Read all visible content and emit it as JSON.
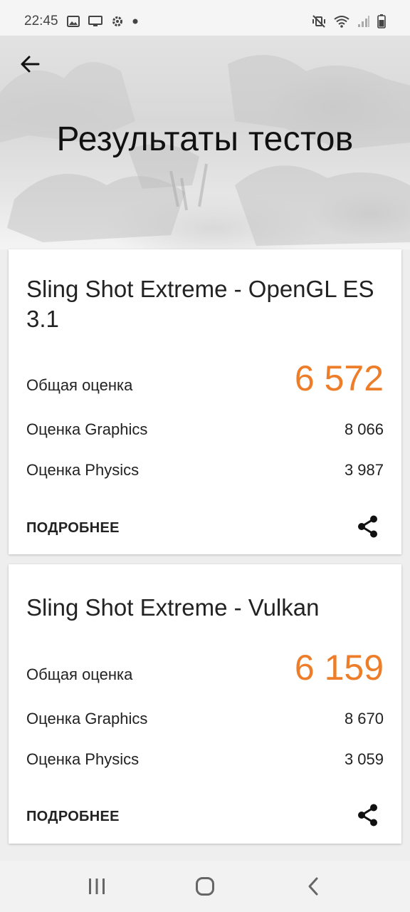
{
  "status_bar": {
    "time": "22:45",
    "left_icons": [
      "gallery-icon",
      "cast-icon",
      "settings-icon",
      "dot-icon"
    ],
    "right_icons": [
      "mute-vibrate-icon",
      "wifi-icon",
      "signal-icon",
      "battery-icon"
    ]
  },
  "header": {
    "title": "Результаты тестов",
    "back_icon": "arrow-left-icon"
  },
  "results": [
    {
      "title": "Sling Shot Extreme - OpenGL ES 3.1",
      "total_label": "Общая оценка",
      "total_value": "6 572",
      "graphics_label": "Оценка Graphics",
      "graphics_value": "8 066",
      "physics_label": "Оценка Physics",
      "physics_value": "3 987",
      "more_label": "ПОДРОБНЕЕ",
      "share_icon": "share-icon"
    },
    {
      "title": "Sling Shot Extreme - Vulkan",
      "total_label": "Общая оценка",
      "total_value": "6 159",
      "graphics_label": "Оценка Graphics",
      "graphics_value": "8 670",
      "physics_label": "Оценка Physics",
      "physics_value": "3 059",
      "more_label": "ПОДРОБНЕЕ",
      "share_icon": "share-icon"
    }
  ],
  "nav_bar": {
    "buttons": [
      "recent-apps-icon",
      "home-icon",
      "back-icon"
    ]
  },
  "colors": {
    "accent": "#ee7d2a",
    "card_background": "#ffffff",
    "page_background": "#eeeeee"
  }
}
